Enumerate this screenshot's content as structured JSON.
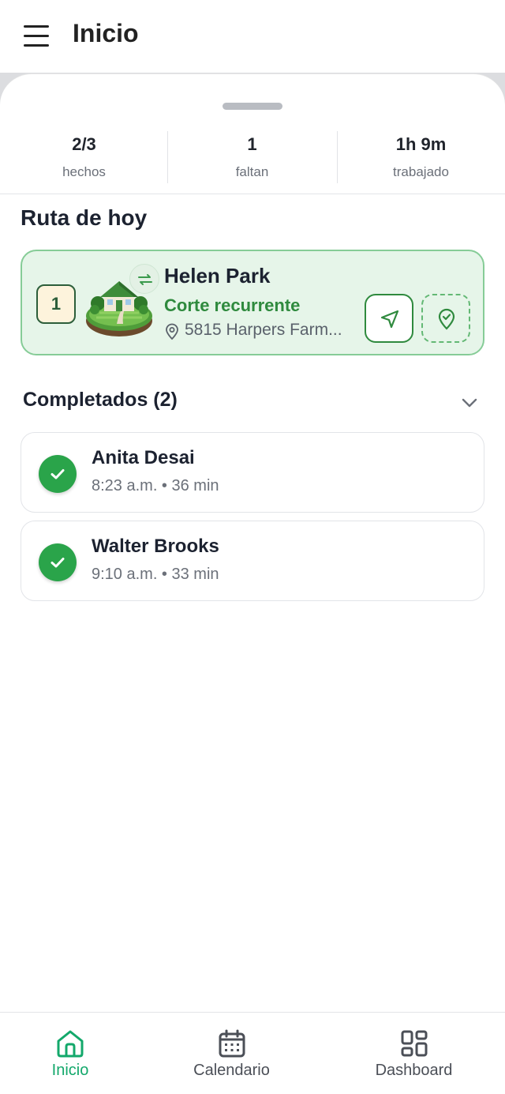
{
  "header": {
    "title": "Inicio",
    "menu_icon": "hamburger-menu-icon"
  },
  "stats": [
    {
      "value": "2/3",
      "label": "hechos"
    },
    {
      "value": "1",
      "label": "faltan"
    },
    {
      "value": "1h 9m",
      "label": "trabajado"
    }
  ],
  "route": {
    "title": "Ruta de hoy",
    "stop": {
      "order": "1",
      "name": "Helen Park",
      "service": "Corte recurrente",
      "address": "5815 Harpers Farm...",
      "image": "house-lawn-illustration",
      "badge_icon": "recurring-icon",
      "actions": [
        "navigate-icon",
        "check-in-pin-icon"
      ]
    }
  },
  "completed": {
    "title": "Completados (2)",
    "items": [
      {
        "name": "Anita Desai",
        "meta": "8:23 a.m. • 36 min"
      },
      {
        "name": "Walter Brooks",
        "meta": "9:10 a.m. • 33 min"
      }
    ]
  },
  "nav": {
    "tabs": [
      {
        "label": "Inicio",
        "icon": "home-icon",
        "active": true
      },
      {
        "label": "Calendario",
        "icon": "calendar-icon",
        "active": false
      },
      {
        "label": "Dashboard",
        "icon": "dashboard-icon",
        "active": false
      }
    ]
  },
  "colors": {
    "accent": "#2f8a3e",
    "active_tab": "#13a86b",
    "inactive_tab": "#4b4f57",
    "card_bg": "#e6f5e9",
    "check": "#2aa44a"
  }
}
